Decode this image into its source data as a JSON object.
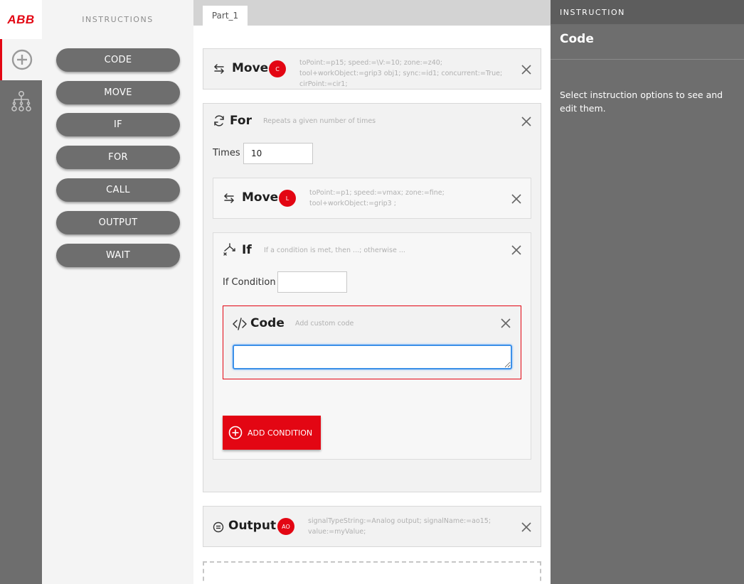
{
  "brand": {
    "logo_text": "ABB",
    "accent_color": "#e30613",
    "rail_color": "#6e6e6e"
  },
  "rail": [
    {
      "name": "add",
      "icon": "plus-circle-icon",
      "active": true
    },
    {
      "name": "structure",
      "icon": "hierarchy-icon",
      "active": false
    }
  ],
  "instructions_panel": {
    "title": "INSTRUCTIONS",
    "items": [
      "CODE",
      "MOVE",
      "IF",
      "FOR",
      "CALL",
      "OUTPUT",
      "WAIT"
    ]
  },
  "editor": {
    "tab": "Part_1",
    "blocks": {
      "move1": {
        "title": "Move",
        "badge": "C",
        "desc": "toPoint:=p15; speed:=\\V:=10; zone:=z40; tool+workObject:=grip3 obj1; sync:=id1; concurrent:=True; cirPoint:=cir1;"
      },
      "for": {
        "title": "For",
        "desc": "Repeats a given number of times",
        "times_label": "Times",
        "times_value": "10",
        "move": {
          "title": "Move",
          "badge": "L",
          "desc": "toPoint:=p1; speed:=vmax; zone:=fine; tool+workObject:=grip3 ;"
        },
        "if": {
          "title": "If",
          "desc": "If a condition is met, then ...; otherwise ...",
          "condition_label": "If Condition",
          "condition_value": "",
          "code": {
            "title": "Code",
            "desc": "Add custom code",
            "value": ""
          },
          "add_condition_label": "ADD CONDITION"
        }
      },
      "output": {
        "title": "Output",
        "badge": "AO",
        "desc": "signalTypeString:=Analog output; signalName:=ao15; value:=myValue;"
      }
    }
  },
  "right_panel": {
    "header": "INSTRUCTION",
    "title": "Code",
    "hint": "Select instruction options to see and edit them."
  }
}
